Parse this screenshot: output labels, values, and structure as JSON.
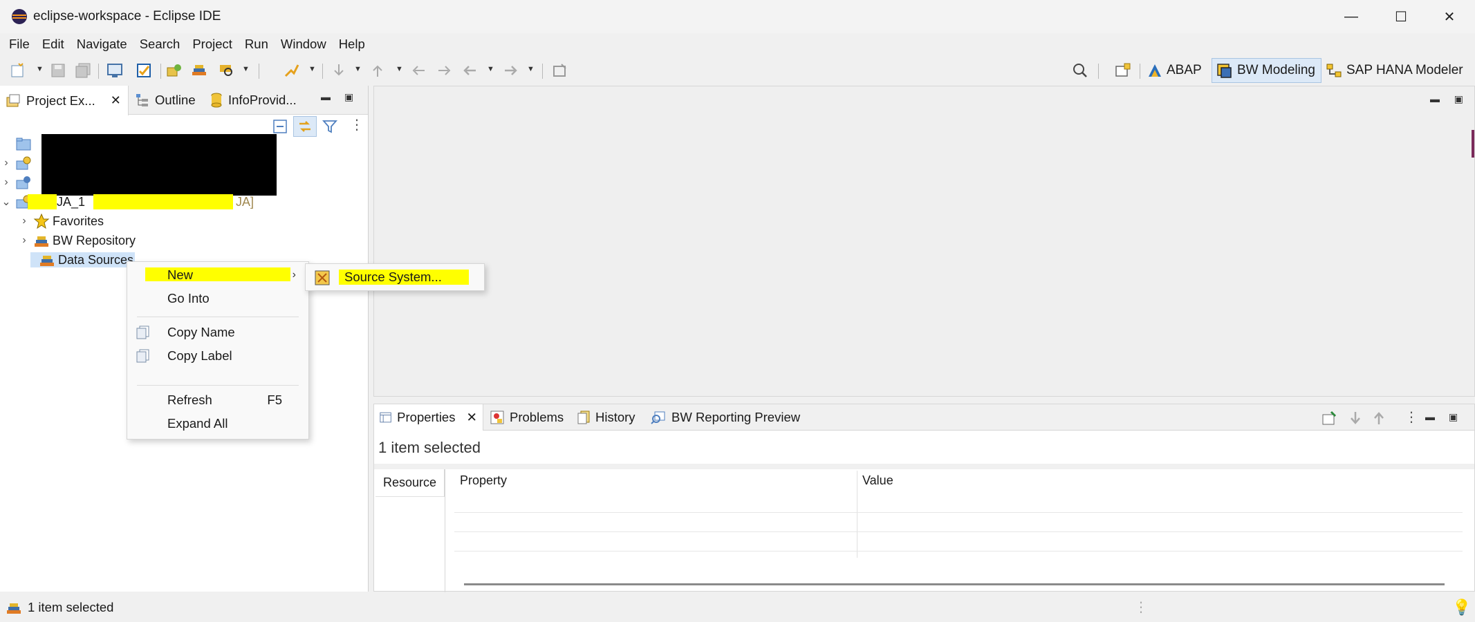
{
  "window": {
    "title": "eclipse-workspace - Eclipse IDE",
    "minimize": "—",
    "maximize": "☐",
    "close": "✕"
  },
  "menu": [
    "File",
    "Edit",
    "Navigate",
    "Search",
    "Project",
    "Run",
    "Window",
    "Help"
  ],
  "perspectives": [
    {
      "label": "ABAP",
      "icon": "abap-perspective-icon",
      "active": false
    },
    {
      "label": "BW Modeling",
      "icon": "bw-modeling-perspective-icon",
      "active": true
    },
    {
      "label": "SAP HANA Modeler",
      "icon": "hana-modeler-perspective-icon",
      "active": false
    }
  ],
  "left_tabs": [
    {
      "label": "Project Ex...",
      "icon": "project-explorer-icon",
      "active": true
    },
    {
      "label": "Outline",
      "icon": "outline-icon",
      "active": false
    },
    {
      "label": "InfoProvid...",
      "icon": "infoprovider-icon",
      "active": false
    }
  ],
  "tree": {
    "project_label_a": "JA_1",
    "project_label_b": "JA]",
    "children": [
      {
        "label": "Favorites",
        "icon": "star-icon"
      },
      {
        "label": "BW Repository",
        "icon": "bw-repository-icon"
      },
      {
        "label": "Data Sources",
        "icon": "data-sources-icon"
      }
    ]
  },
  "context_menu": {
    "new": "New",
    "go_into": "Go Into",
    "copy_name": "Copy Name",
    "copy_label": "Copy Label",
    "refresh": "Refresh",
    "refresh_shortcut": "F5",
    "expand_all": "Expand All"
  },
  "submenu": {
    "source_system": "Source System..."
  },
  "bottom_tabs": [
    {
      "label": "Properties",
      "icon": "properties-icon",
      "active": true
    },
    {
      "label": "Problems",
      "icon": "problems-icon",
      "active": false
    },
    {
      "label": "History",
      "icon": "history-icon",
      "active": false
    },
    {
      "label": "BW Reporting Preview",
      "icon": "bw-reporting-preview-icon",
      "active": false
    }
  ],
  "properties": {
    "header": "1 item selected",
    "section_tab": "Resource",
    "col_property": "Property",
    "col_value": "Value"
  },
  "status": {
    "text": "1 item selected"
  },
  "colors": {
    "highlight": "#ffff00",
    "selection": "#dce9f7"
  }
}
